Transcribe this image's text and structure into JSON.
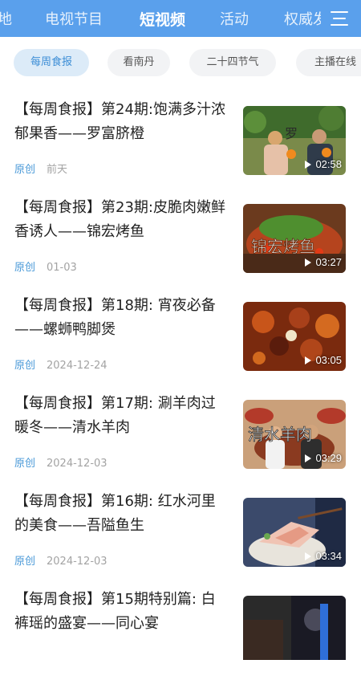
{
  "nav": {
    "tabs": [
      "地",
      "电视节目",
      "短视频",
      "活动",
      "权威发"
    ],
    "active": 2,
    "menu_icon": "hamburger-menu-icon",
    "bg": "#5aa0ec"
  },
  "chips": [
    "每周食报",
    "看南丹",
    "二十四节气",
    "主播在线"
  ],
  "active_chip": 0,
  "items": [
    {
      "title": "【每周食报】第24期:饱满多汁浓郁果香——罗富脐橙",
      "tag": "原创",
      "date": "前天",
      "duration": "02:58"
    },
    {
      "title": "【每周食报】第23期:皮脆肉嫩鲜香诱人——锦宏烤鱼",
      "tag": "原创",
      "date": "01-03",
      "duration": "03:27"
    },
    {
      "title": "【每周食报】第18期: 宵夜必备——螺蛳鸭脚煲",
      "tag": "原创",
      "date": "2024-12-24",
      "duration": "03:05"
    },
    {
      "title": "【每周食报】第17期: 涮羊肉过暖冬——清水羊肉",
      "tag": "原创",
      "date": "2024-12-03",
      "duration": "03:29"
    },
    {
      "title": "【每周食报】第16期: 红水河里的美食——吾隘鱼生",
      "tag": "原创",
      "date": "2024-12-03",
      "duration": "03:34"
    },
    {
      "title": "【每周食报】第15期特别篇: 白裤瑶的盛宴——同心宴",
      "tag": "",
      "date": "",
      "duration": ""
    }
  ]
}
